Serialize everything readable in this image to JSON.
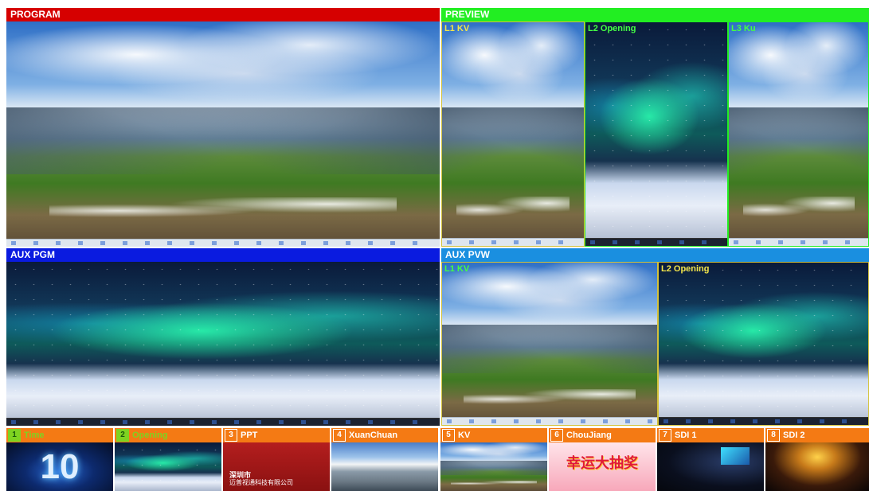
{
  "program": {
    "label": "PROGRAM"
  },
  "preview": {
    "label": "PREVIEW",
    "layers": [
      {
        "label": "L1 KV"
      },
      {
        "label": "L2 Opening"
      },
      {
        "label": "L3 Ku"
      }
    ]
  },
  "aux_pgm": {
    "label": "AUX PGM"
  },
  "aux_pvw": {
    "label": "AUX PVW",
    "layers": [
      {
        "label": "L1 KV"
      },
      {
        "label": "L2 Opening"
      }
    ]
  },
  "sources": [
    {
      "num": "1",
      "label": "Time",
      "active": true
    },
    {
      "num": "2",
      "label": "Opening",
      "active": true
    },
    {
      "num": "3",
      "label": "PPT",
      "active": false
    },
    {
      "num": "4",
      "label": "XuanChuan",
      "active": false
    },
    {
      "num": "5",
      "label": "KV",
      "active": false
    },
    {
      "num": "6",
      "label": "ChouJiang",
      "active": false
    },
    {
      "num": "7",
      "label": "SDI 1",
      "active": false
    },
    {
      "num": "8",
      "label": "SDI 2",
      "active": false
    }
  ],
  "thumbs": {
    "time_digits": "10",
    "ppt_line1": "深圳市",
    "ppt_line2": "迈普视通科技有限公司",
    "choujiang_text": "幸运大抽奖"
  },
  "colors": {
    "program": "#d60000",
    "preview": "#22ee22",
    "aux_pgm": "#0a1be0",
    "aux_pvw": "#1a8fe0",
    "source_bar": "#f47a14",
    "active_tally": "#7ed321",
    "preview_layer_border": "#d4c23a"
  }
}
